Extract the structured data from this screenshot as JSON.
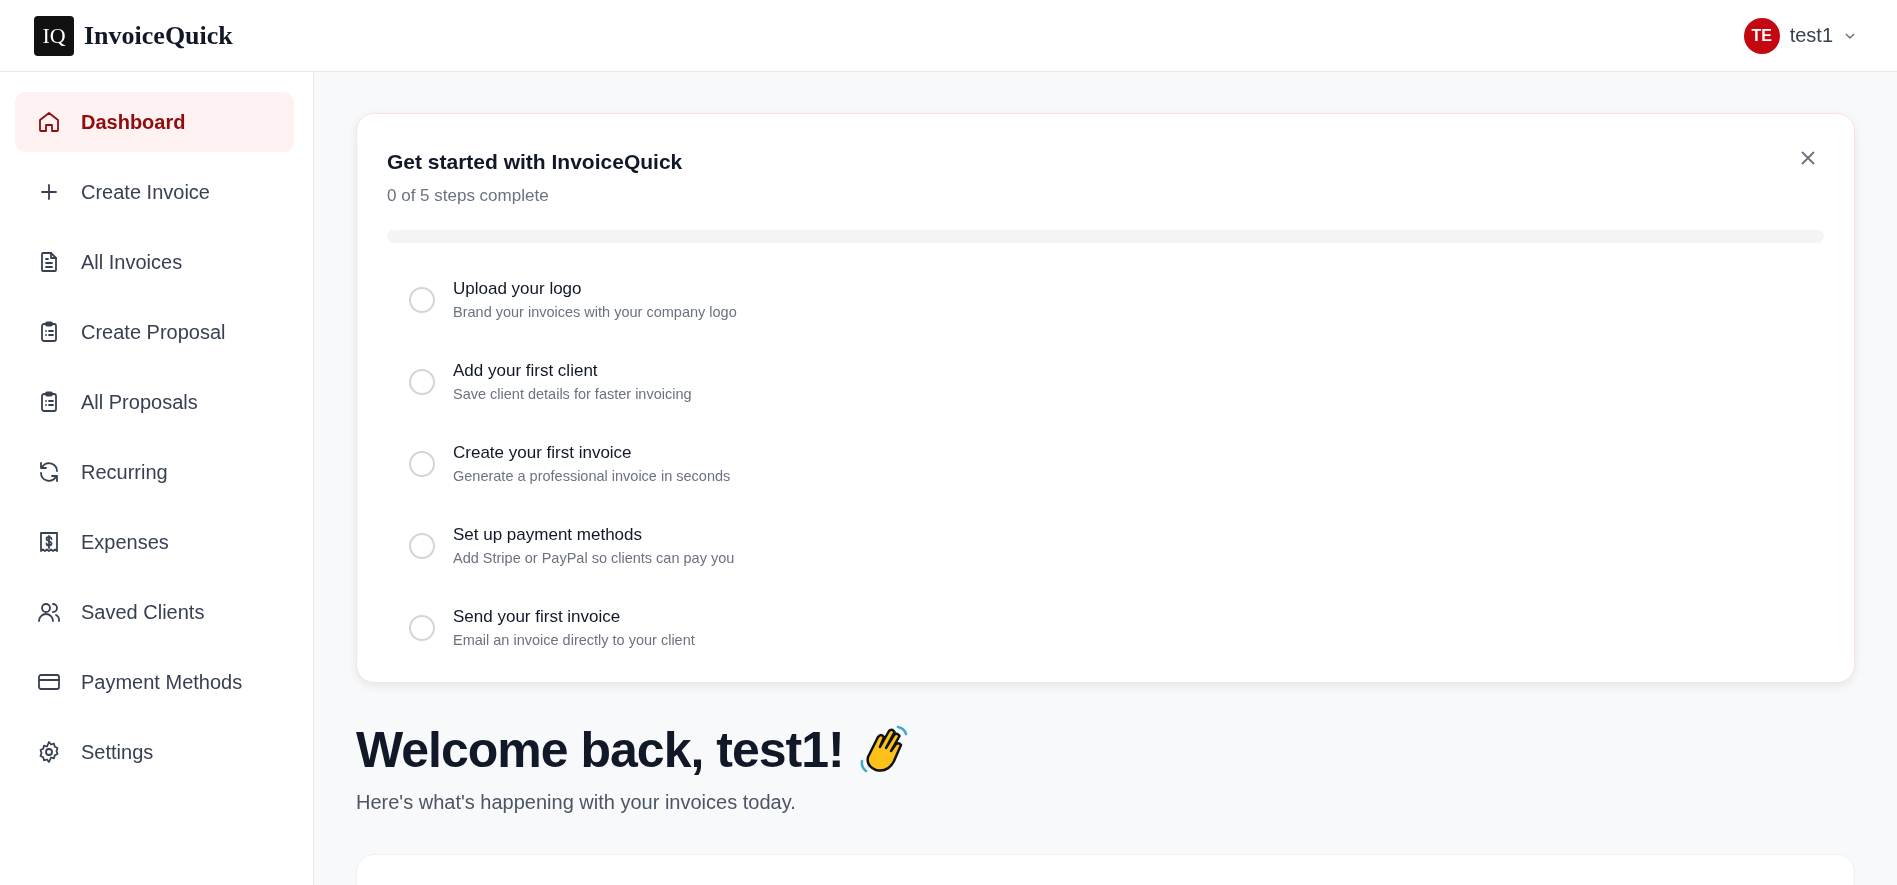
{
  "brand": {
    "mark": "IQ",
    "name": "InvoiceQuick"
  },
  "user": {
    "initials": "TE",
    "name": "test1"
  },
  "sidebar": {
    "items": [
      {
        "label": "Dashboard",
        "selected": true
      },
      {
        "label": "Create Invoice",
        "selected": false
      },
      {
        "label": "All Invoices",
        "selected": false
      },
      {
        "label": "Create Proposal",
        "selected": false
      },
      {
        "label": "All Proposals",
        "selected": false
      },
      {
        "label": "Recurring",
        "selected": false
      },
      {
        "label": "Expenses",
        "selected": false
      },
      {
        "label": "Saved Clients",
        "selected": false
      },
      {
        "label": "Payment Methods",
        "selected": false
      },
      {
        "label": "Settings",
        "selected": false
      }
    ]
  },
  "onboarding": {
    "title": "Get started with InvoiceQuick",
    "progress_text": "0 of 5 steps complete",
    "level": 0,
    "steps": [
      {
        "title": "Upload your logo",
        "description": "Brand your invoices with your company logo",
        "checked": false
      },
      {
        "title": "Add your first client",
        "description": "Save client details for faster invoicing",
        "checked": false
      },
      {
        "title": "Create your first invoice",
        "description": "Generate a professional invoice in seconds",
        "checked": false
      },
      {
        "title": "Set up payment methods",
        "description": "Add Stripe or PayPal so clients can pay you",
        "checked": false
      },
      {
        "title": "Send your first invoice",
        "description": "Email an invoice directly to your client",
        "checked": false
      }
    ]
  },
  "welcome": {
    "heading": "Welcome back, test1!",
    "subtitle": "Here's what's happening with your invoices today."
  }
}
